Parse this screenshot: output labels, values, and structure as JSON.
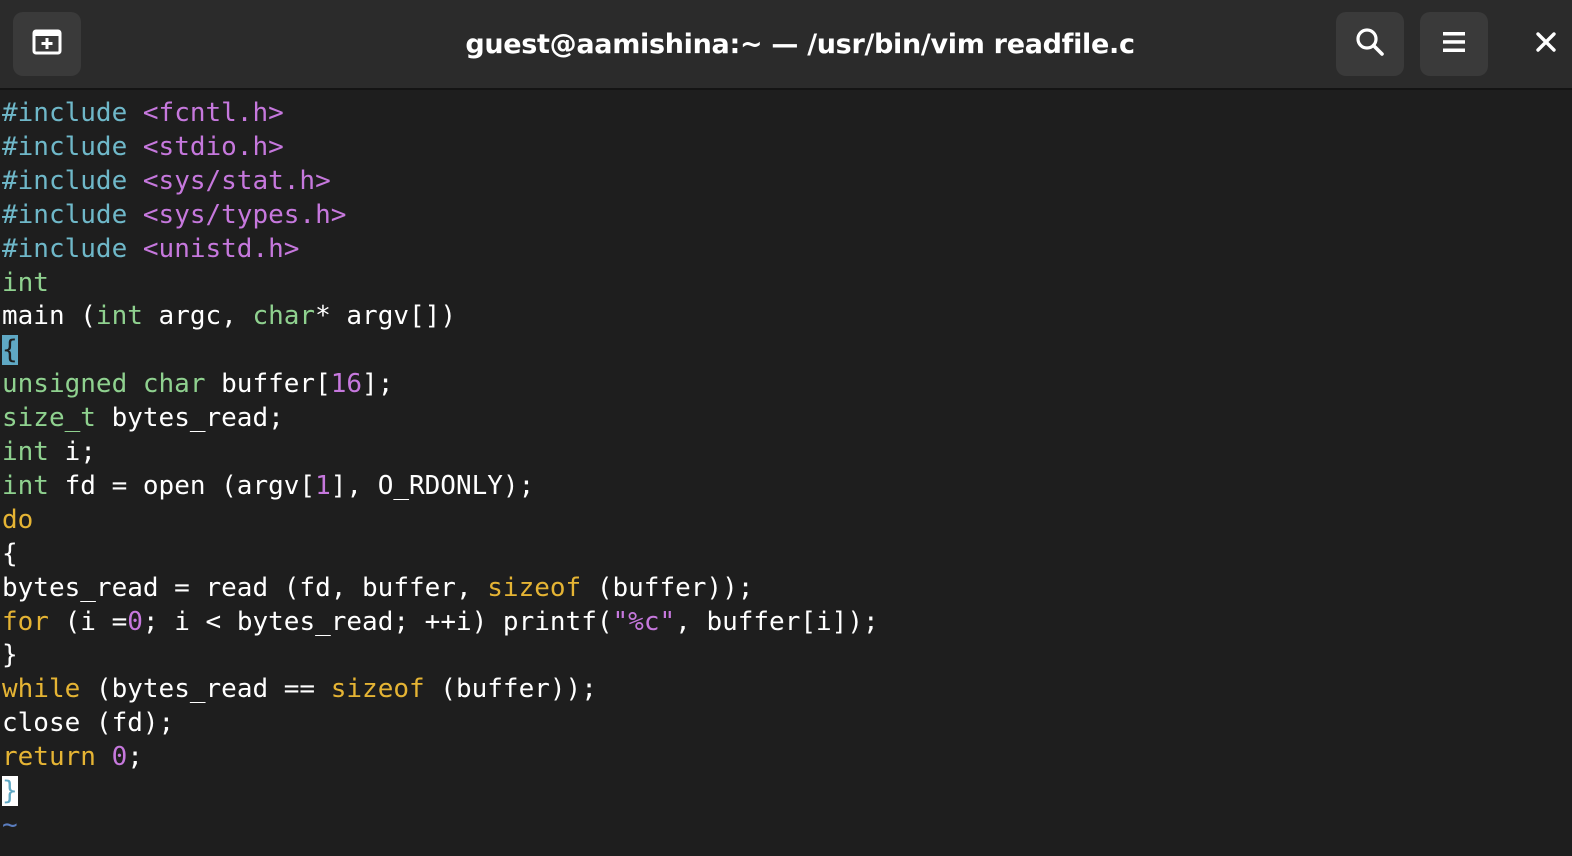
{
  "window": {
    "title": "guest@aamishina:~ — /usr/bin/vim readfile.c"
  },
  "icons": {
    "new_tab": "new-tab-icon",
    "search": "search-icon",
    "menu": "hamburger-menu-icon",
    "close": "close-icon"
  },
  "colors": {
    "preprocessor": "#6fb8c9",
    "include_path": "#c678dd",
    "type": "#8fd18f",
    "keyword": "#e5b434",
    "number": "#c678dd",
    "cursor": "#5fa8c4"
  },
  "editor": {
    "lines": [
      [
        {
          "t": "#include",
          "c": "pre"
        },
        {
          "t": " ",
          "c": "plain"
        },
        {
          "t": "<fcntl.h>",
          "c": "inc"
        }
      ],
      [
        {
          "t": "#include",
          "c": "pre"
        },
        {
          "t": " ",
          "c": "plain"
        },
        {
          "t": "<stdio.h>",
          "c": "inc"
        }
      ],
      [
        {
          "t": "#include",
          "c": "pre"
        },
        {
          "t": " ",
          "c": "plain"
        },
        {
          "t": "<sys/stat.h>",
          "c": "inc"
        }
      ],
      [
        {
          "t": "#include",
          "c": "pre"
        },
        {
          "t": " ",
          "c": "plain"
        },
        {
          "t": "<sys/types.h>",
          "c": "inc"
        }
      ],
      [
        {
          "t": "#include",
          "c": "pre"
        },
        {
          "t": " ",
          "c": "plain"
        },
        {
          "t": "<unistd.h>",
          "c": "inc"
        }
      ],
      [
        {
          "t": "int",
          "c": "type"
        }
      ],
      [
        {
          "t": "main (",
          "c": "plain"
        },
        {
          "t": "int",
          "c": "type"
        },
        {
          "t": " argc, ",
          "c": "plain"
        },
        {
          "t": "char",
          "c": "type"
        },
        {
          "t": "* argv[])",
          "c": "plain"
        }
      ],
      [
        {
          "t": "{",
          "c": "cursor"
        }
      ],
      [
        {
          "t": "unsigned char",
          "c": "type"
        },
        {
          "t": " buffer[",
          "c": "plain"
        },
        {
          "t": "16",
          "c": "num"
        },
        {
          "t": "];",
          "c": "plain"
        }
      ],
      [
        {
          "t": "size_t",
          "c": "type"
        },
        {
          "t": " bytes_read;",
          "c": "plain"
        }
      ],
      [
        {
          "t": "int",
          "c": "type"
        },
        {
          "t": " i;",
          "c": "plain"
        }
      ],
      [
        {
          "t": "int",
          "c": "type"
        },
        {
          "t": " fd = open (argv[",
          "c": "plain"
        },
        {
          "t": "1",
          "c": "num"
        },
        {
          "t": "], O_RDONLY);",
          "c": "plain"
        }
      ],
      [
        {
          "t": "do",
          "c": "kw"
        }
      ],
      [
        {
          "t": "{",
          "c": "plain"
        }
      ],
      [
        {
          "t": "bytes_read = read (fd, buffer, ",
          "c": "plain"
        },
        {
          "t": "sizeof",
          "c": "kw"
        },
        {
          "t": " (buffer));",
          "c": "plain"
        }
      ],
      [
        {
          "t": "for",
          "c": "kw"
        },
        {
          "t": " (i =",
          "c": "plain"
        },
        {
          "t": "0",
          "c": "num"
        },
        {
          "t": "; i < bytes_read; ++i) printf(",
          "c": "plain"
        },
        {
          "t": "\"%c\"",
          "c": "str"
        },
        {
          "t": ", buffer[i]);",
          "c": "plain"
        }
      ],
      [
        {
          "t": "}",
          "c": "plain"
        }
      ],
      [
        {
          "t": "while",
          "c": "kw"
        },
        {
          "t": " (bytes_read == ",
          "c": "plain"
        },
        {
          "t": "sizeof",
          "c": "kw"
        },
        {
          "t": " (buffer));",
          "c": "plain"
        }
      ],
      [
        {
          "t": "close (fd);",
          "c": "plain"
        }
      ],
      [
        {
          "t": "return",
          "c": "kw"
        },
        {
          "t": " ",
          "c": "plain"
        },
        {
          "t": "0",
          "c": "num"
        },
        {
          "t": ";",
          "c": "plain"
        }
      ],
      [
        {
          "t": "}",
          "c": "cursorwhite"
        }
      ],
      [
        {
          "t": "~",
          "c": "tilde"
        }
      ]
    ]
  }
}
